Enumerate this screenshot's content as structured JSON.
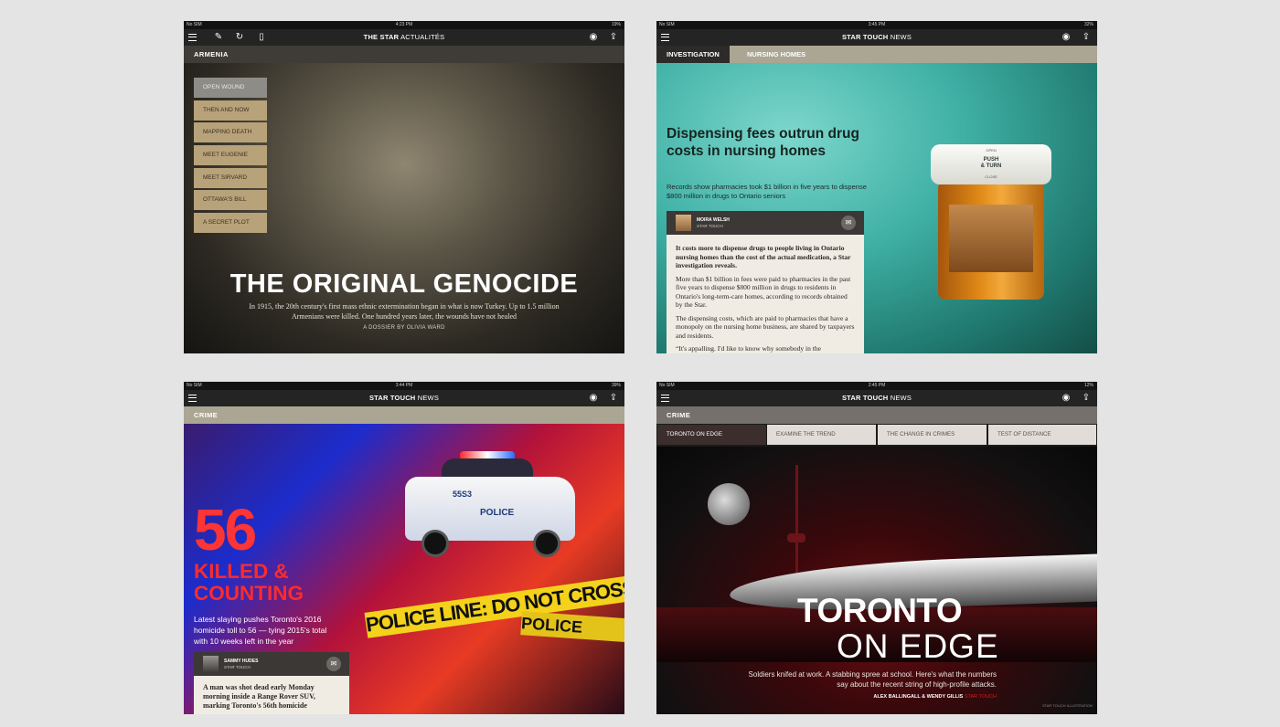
{
  "colors": {
    "background": "#e4e4e4",
    "accent_red": "#ff2b2b",
    "topbar": "#242424"
  },
  "tablets": {
    "t1": {
      "status": {
        "carrier": "No SIM",
        "time": "4:23 PM",
        "battery": "19%"
      },
      "title_bold": "THE STAR",
      "title_rest": "ACTUALITÉS",
      "section": "ARMENIA",
      "menu": [
        "OPEN WOUND",
        "THEN AND NOW",
        "MAPPING DEATH",
        "MEET EUGENIE",
        "MEET SIRVARD",
        "OTTAWA'S BILL",
        "A SECRET PLOT"
      ],
      "headline": "THE ORIGINAL GENOCIDE",
      "deck": "In 1915, the 20th century's first mass ethnic extermination began in what is now Turkey. Up to 1.5 million Armenians were killed. One hundred years later, the wounds have not healed",
      "byline": "A DOSSIER BY OLIVIA WARD"
    },
    "t2": {
      "status": {
        "carrier": "No SIM",
        "time": "3:45 PM",
        "battery": "32%"
      },
      "title_bold": "STAR TOUCH",
      "title_rest": "NEWS",
      "tabs": [
        "INVESTIGATION",
        "NURSING HOMES"
      ],
      "headline": "Dispensing fees outrun drug costs in nursing homes",
      "deck": "Records show pharmacies took $1 billion in five years to dispense $800 million in drugs to Ontario seniors",
      "author": "MOIRA WELSH",
      "author_org": "STAR TOUCH",
      "lede": "It costs more to dispense drugs to people living in Ontario nursing homes than the cost of the actual medication, a Star investigation reveals.",
      "para2": "More than $1 billion in fees were paid to pharmacies in the past five years to dispense $800 million in drugs to residents in Ontario's long-term-care homes, according to records obtained by the Star.",
      "para3": "The dispensing costs, which are paid to pharmacies that have a monopoly on the nursing home business, are shared by taxpayers and residents.",
      "para4": "“It's appalling. I'd like to know why somebody in the",
      "cap_line1": "OPEN",
      "cap_line2": "PUSH",
      "cap_line3": "& TURN",
      "cap_line4": "CLOSE"
    },
    "t3": {
      "status": {
        "carrier": "No SIM",
        "time": "3:44 PM",
        "battery": "39%"
      },
      "title_bold": "STAR TOUCH",
      "title_rest": "NEWS",
      "section": "CRIME",
      "big_number": "56",
      "headline_line1": "KILLED &",
      "headline_line2": "COUNTING",
      "deck": "Latest slaying pushes Toronto's 2016 homicide toll to 56 — tying 2015's total with 10 weeks left in the year",
      "tape1": "POLICE LINE: DO NOT CROSS",
      "tape2": "POLICE",
      "car_number": "55S3",
      "car_label": "POLICE",
      "author": "SAMMY HUDES",
      "author_org": "STAR TOUCH",
      "body": "A man was shot dead early Monday morning inside a Range Rover SUV, marking Toronto's 56th homicide"
    },
    "t4": {
      "status": {
        "carrier": "No SIM",
        "time": "2:45 PM",
        "battery": "12%"
      },
      "title_bold": "STAR TOUCH",
      "title_rest": "NEWS",
      "section": "CRIME",
      "subtabs": [
        "TORONTO ON EDGE",
        "EXAMINE THE TREND",
        "THE CHANGE IN CRIMES",
        "TEST OF DISTANCE"
      ],
      "headline_line1": "TORONTO",
      "headline_line2": "ON EDGE",
      "deck": "Soldiers knifed at work. A stabbing spree at school. Here's what the numbers say about the recent string of high-profile attacks.",
      "byline": "ALEX BALLINGALL & WENDY GILLIS",
      "byline_org": "STAR TOUCH",
      "illustration": "STAR TOUCH ILLUSTRATION"
    }
  }
}
